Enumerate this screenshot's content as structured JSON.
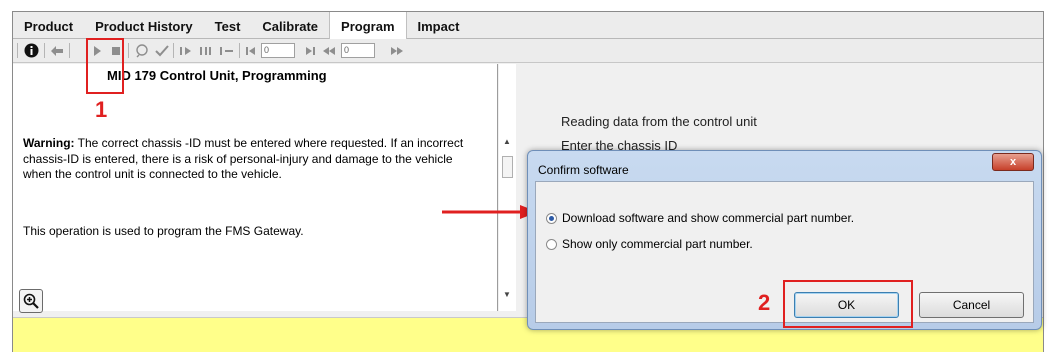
{
  "tabs": [
    {
      "label": "Product"
    },
    {
      "label": "Product History"
    },
    {
      "label": "Test"
    },
    {
      "label": "Calibrate"
    },
    {
      "label": "Program"
    },
    {
      "label": "Impact"
    }
  ],
  "toolbar": {
    "input1_value": "0",
    "input2_value": "0"
  },
  "left": {
    "title": "MID 179 Control Unit, Programming",
    "warning_label": "Warning:",
    "warning_text": " The correct chassis -ID must be entered where requested. If an incorrect chassis-ID is entered, there is a risk of personal-injury and damage to the vehicle when the control unit is connected to the vehicle.",
    "info_text": "This operation is used to program the FMS Gateway."
  },
  "right": {
    "lines": [
      "Reading data from the control unit",
      "Enter the chassis ID"
    ]
  },
  "dialog": {
    "title": "Confirm software",
    "close_label": "x",
    "options": [
      {
        "label": "Download software and show commercial part number.",
        "selected": true
      },
      {
        "label": "Show only commercial part number.",
        "selected": false
      }
    ],
    "ok_label": "OK",
    "cancel_label": "Cancel"
  },
  "annotations": {
    "step1": "1",
    "step2": "2",
    "color": "#e02020"
  }
}
